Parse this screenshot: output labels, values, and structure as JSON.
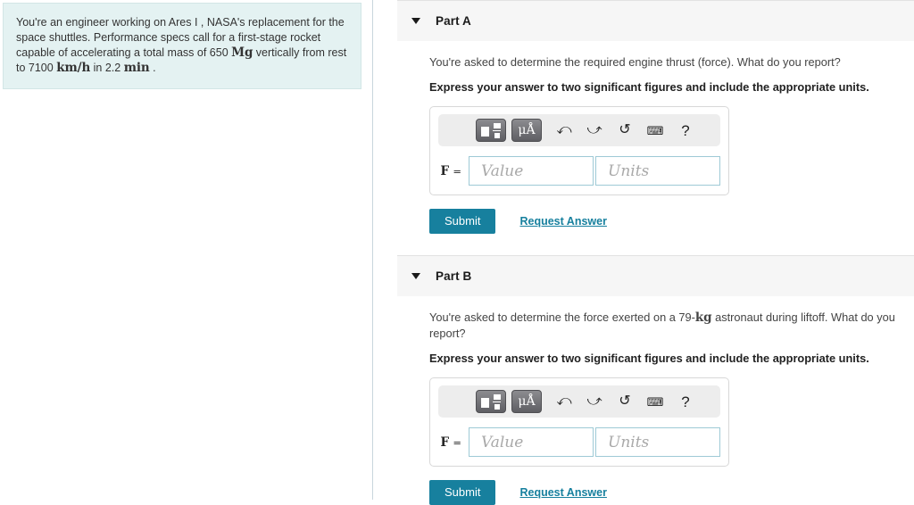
{
  "problem": {
    "text_segments": [
      {
        "t": "You're an engineer working on Ares I , NASA's replacement for the space shuttles. Performance specs call for a first-stage rocket capable of accelerating a total mass of 650 ",
        "math": false
      },
      {
        "t": "Mg",
        "math": true
      },
      {
        "t": " vertically from rest to 7100 ",
        "math": false
      },
      {
        "t": "km/h",
        "math": true
      },
      {
        "t": " in 2.2 ",
        "math": false
      },
      {
        "t": "min",
        "math": true
      },
      {
        "t": " .",
        "math": false
      }
    ],
    "plain": "You're an engineer working on Ares I , NASA's replacement for the space shuttles. Performance specs call for a first-stage rocket capable of accelerating a total mass of 650 Mg vertically from rest to 7100 km/h in 2.2 min ."
  },
  "parts": [
    {
      "id": "a",
      "title": "Part A",
      "question_prefix": "You're asked to determine the required engine thrust (force). What do you report?",
      "question_math": "",
      "question_suffix": "",
      "instruction": "Express your answer to two significant figures and include the appropriate units.",
      "answer": {
        "variable": "F",
        "equals": "=",
        "value_placeholder": "Value",
        "value": "",
        "units_placeholder": "Units",
        "units": ""
      },
      "submit_label": "Submit",
      "request_label": "Request Answer"
    },
    {
      "id": "b",
      "title": "Part B",
      "question_prefix": "You're asked to determine the force exerted on a 79-",
      "question_math": "kg",
      "question_suffix": " astronaut during liftoff. What do you report?",
      "instruction": "Express your answer to two significant figures and include the appropriate units.",
      "answer": {
        "variable": "F",
        "equals": "=",
        "value_placeholder": "Value",
        "value": "",
        "units_placeholder": "Units",
        "units": ""
      },
      "submit_label": "Submit",
      "request_label": "Request Answer"
    }
  ],
  "toolbar": {
    "template_icon": "math-template-icon",
    "units_label_mu": "μ",
    "units_label_a": "A",
    "units_ring": "°",
    "undo_glyph": "⮠",
    "redo_glyph": "⮡",
    "reset_glyph": "↺",
    "keyboard_glyph": "⌨",
    "help_glyph": "?"
  },
  "colors": {
    "accent_teal": "#17809e",
    "problem_bg": "#e4f2f2",
    "part_header_bg": "#f6f6f6",
    "input_border": "#9ecad6"
  }
}
